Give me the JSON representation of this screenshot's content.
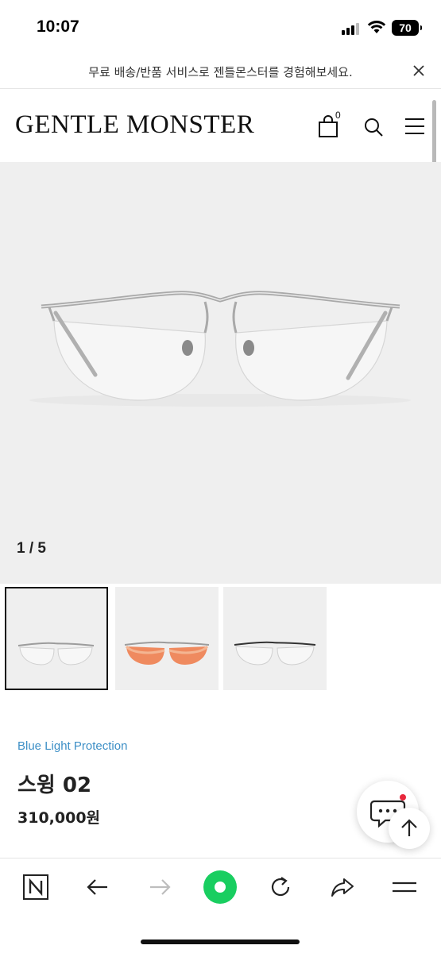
{
  "status_bar": {
    "time": "10:07",
    "battery": "70"
  },
  "promo": {
    "text": "무료 배송/반품 서비스로 젠틀몬스터를 경험해보세요.",
    "close_icon": "close-icon"
  },
  "header": {
    "logo": "GENTLE MONSTER",
    "cart_count": "0",
    "icons": [
      "cart-icon",
      "search-icon",
      "menu-icon"
    ]
  },
  "gallery": {
    "counter": "1 / 5",
    "current": 1,
    "total": 5
  },
  "thumbnails": [
    {
      "name": "silver-clear-lens",
      "active": true
    },
    {
      "name": "silver-orange-lens",
      "active": false
    },
    {
      "name": "black-clear-lens",
      "active": false
    }
  ],
  "product": {
    "category": "Blue Light Protection",
    "name": "스윙 02",
    "price": "310,000원"
  },
  "browser_bar": {
    "icons": [
      "naver-n-icon",
      "back-arrow-icon",
      "forward-arrow-icon",
      "green-home-icon",
      "reload-icon",
      "share-icon",
      "menu-icon"
    ]
  },
  "colors": {
    "accent_green": "#19ce60",
    "category_blue": "#3d8fc6",
    "chat_badge": "#e8283c"
  }
}
